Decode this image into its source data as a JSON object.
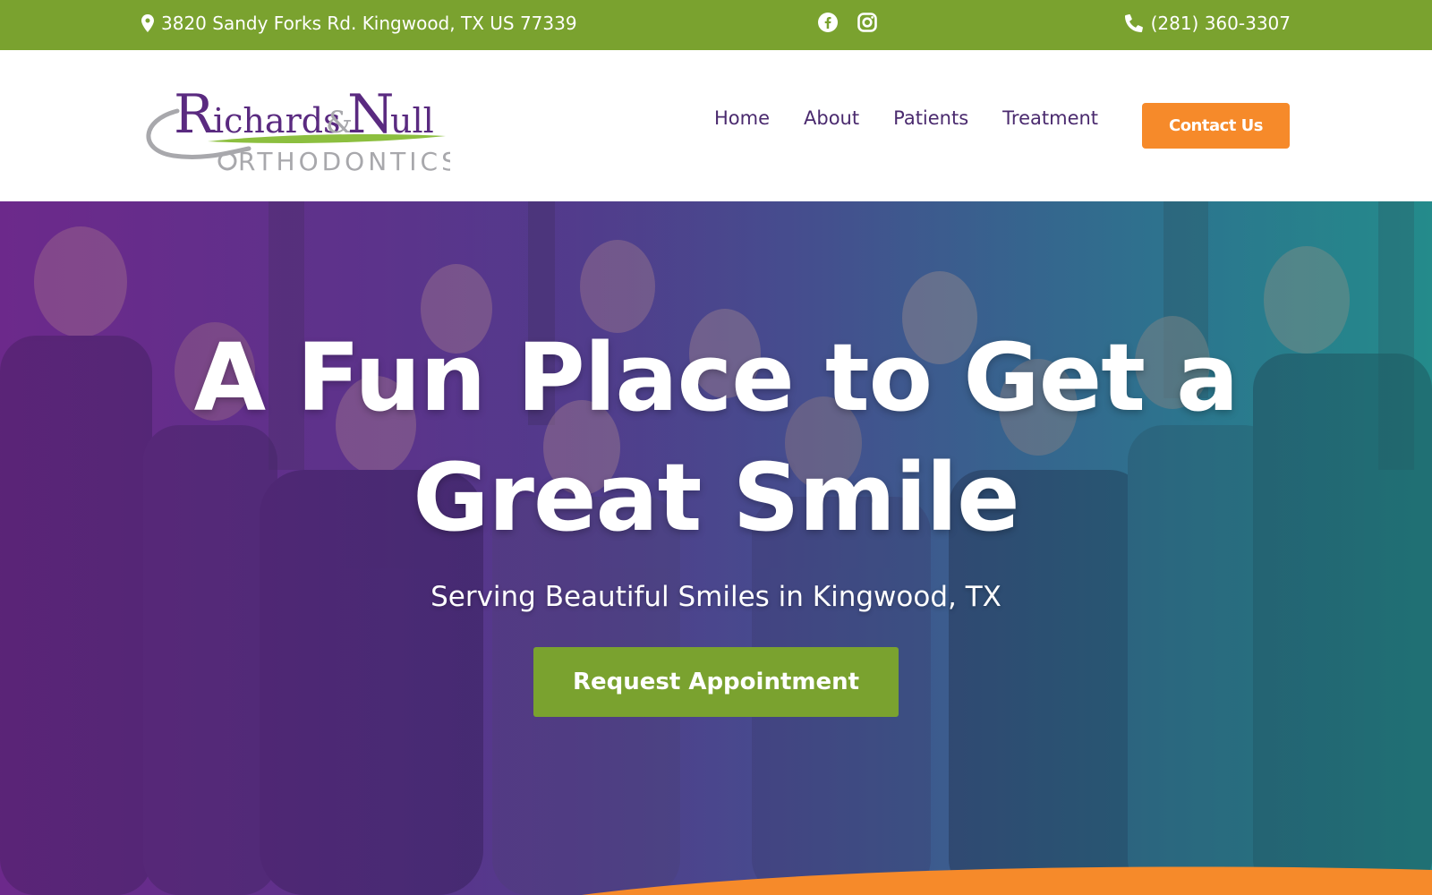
{
  "topbar": {
    "address": "3820 Sandy Forks Rd. Kingwood, TX US 77339",
    "phone": "(281) 360-3307",
    "social": [
      "facebook-icon",
      "instagram-icon"
    ]
  },
  "header": {
    "logo": {
      "line1": "Richards&Null",
      "line2": "ORTHODONTICS"
    },
    "nav": [
      "Home",
      "About",
      "Patients",
      "Treatment"
    ],
    "cta": "Contact Us"
  },
  "hero": {
    "title_line1": "A Fun Place to Get a",
    "title_line2": "Great Smile",
    "subtitle": "Serving Beautiful Smiles in Kingwood, TX",
    "button": "Request Appointment"
  },
  "colors": {
    "green": "#7aa22f",
    "orange": "#f68a2a",
    "purple": "#4a2a6e"
  }
}
